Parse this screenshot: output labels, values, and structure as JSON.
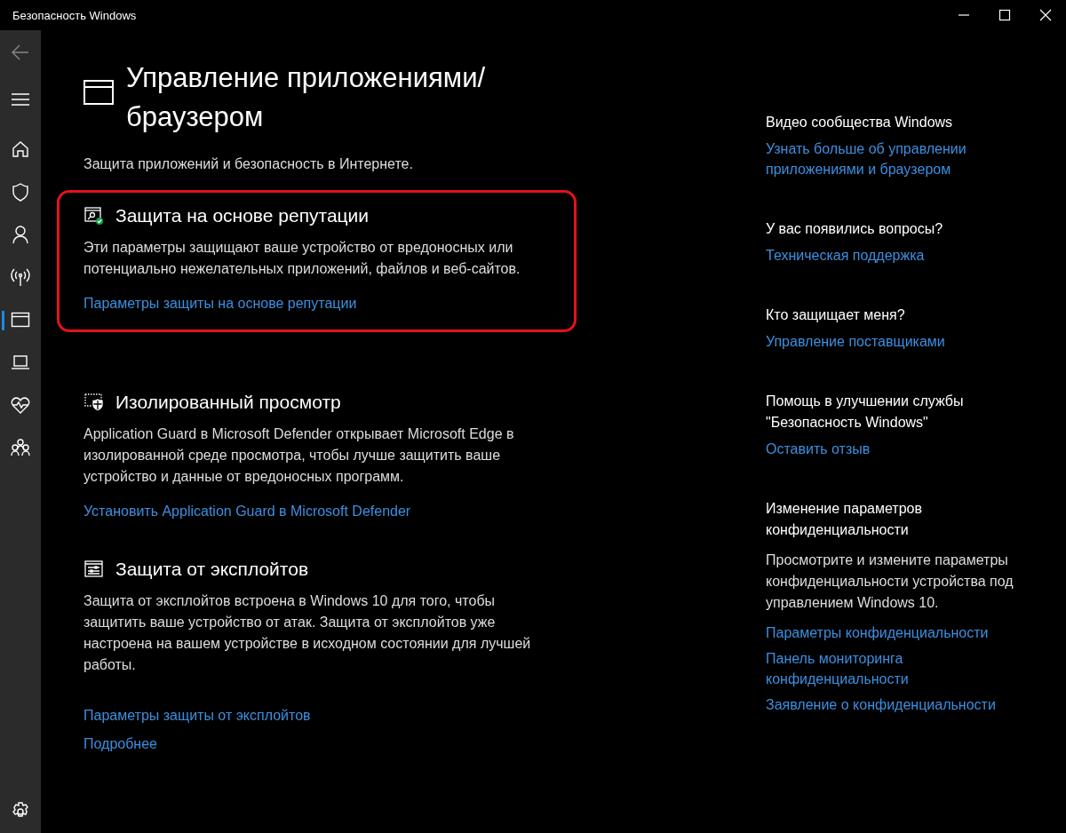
{
  "window": {
    "title": "Безопасность Windows"
  },
  "sidebar": {
    "items": [
      {
        "kind": "back",
        "selected": false
      },
      {
        "kind": "menu",
        "selected": false
      },
      {
        "kind": "home",
        "selected": false
      },
      {
        "kind": "shield",
        "selected": false
      },
      {
        "kind": "person",
        "selected": false
      },
      {
        "kind": "wireless",
        "selected": false
      },
      {
        "kind": "browser",
        "selected": true
      },
      {
        "kind": "laptop",
        "selected": false
      },
      {
        "kind": "heart",
        "selected": false
      },
      {
        "kind": "family",
        "selected": false
      },
      {
        "kind": "settings",
        "selected": false
      }
    ]
  },
  "page": {
    "title": "Управление приложениями/\nбраузером",
    "subtitle": "Защита приложений и безопасность в Интернете."
  },
  "sections": [
    {
      "kind": "reputation",
      "highlighted": true,
      "title": "Защита на основе репутации",
      "text": "Эти параметры защищают ваше устройство от вредоносных или потенциально нежелательных приложений, файлов и веб-сайтов.",
      "links": [
        "Параметры защиты на основе репутации"
      ]
    },
    {
      "kind": "isolated",
      "highlighted": false,
      "title": "Изолированный просмотр",
      "text": "Application Guard в Microsoft Defender открывает Microsoft Edge в изолированной среде просмотра, чтобы лучше защитить ваше устройство и данные от вредоносных программ.",
      "links": [
        "Установить Application Guard в Microsoft Defender"
      ]
    },
    {
      "kind": "exploit",
      "highlighted": false,
      "title": "Защита от эксплойтов",
      "text": "Защита от эксплойтов встроена в Windows 10 для того, чтобы защитить ваше устройство от атак. Защита от эксплойтов уже настроена на вашем устройстве в исходном состоянии для лучшей работы.",
      "links": [
        "Параметры защиты от эксплойтов",
        "Подробнее"
      ]
    }
  ],
  "aside": [
    {
      "title": "Видео сообщества Windows",
      "links": [
        "Узнать больше об управлении приложениями и браузером"
      ]
    },
    {
      "title": "У вас появились вопросы?",
      "links": [
        "Техническая поддержка"
      ]
    },
    {
      "title": "Кто защищает меня?",
      "links": [
        "Управление поставщиками"
      ]
    },
    {
      "title": "Помощь в улучшении службы \"Безопасность Windows\"",
      "links": [
        "Оставить отзыв"
      ]
    },
    {
      "title": "Изменение параметров конфиденциальности",
      "text": "Просмотрите и измените параметры конфиденциальности устройства под управлением Windows 10.",
      "links": [
        "Параметры конфиденциальности",
        "Панель мониторинга конфиденциальности",
        "Заявление о конфиденциальности"
      ]
    }
  ]
}
